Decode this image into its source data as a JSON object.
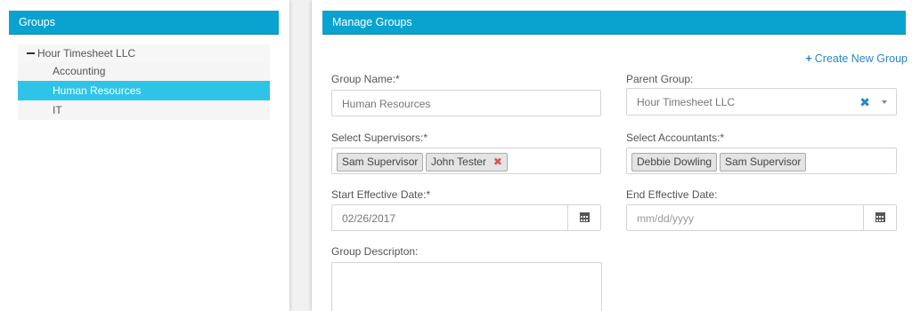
{
  "colors": {
    "accent": "#0aa3cf",
    "selected_bg": "#2ec4e8",
    "link": "#2b86c5",
    "remove": "#d9534f"
  },
  "groups_panel": {
    "title": "Groups",
    "tree": {
      "root": {
        "label": "Hour Timesheet LLC",
        "expanded": true
      },
      "children": [
        {
          "label": "Accounting",
          "selected": false
        },
        {
          "label": "Human Resources",
          "selected": true
        },
        {
          "label": "IT",
          "selected": false
        }
      ]
    }
  },
  "manage_panel": {
    "title": "Manage Groups",
    "create_link": "Create New Group",
    "group_name": {
      "label": "Group Name:*",
      "value": "Human Resources"
    },
    "parent_group": {
      "label": "Parent Group:",
      "value": "Hour Timesheet LLC"
    },
    "supervisors": {
      "label": "Select Supervisors:*",
      "tags": [
        "Sam Supervisor",
        "John Tester"
      ]
    },
    "accountants": {
      "label": "Select Accountants:*",
      "tags": [
        "Debbie Dowling",
        "Sam Supervisor"
      ]
    },
    "start_date": {
      "label": "Start Effective Date:*",
      "value": "02/26/2017"
    },
    "end_date": {
      "label": "End Effective Date:",
      "placeholder": "mm/dd/yyyy"
    },
    "description": {
      "label": "Group Descripton:",
      "value": ""
    }
  }
}
